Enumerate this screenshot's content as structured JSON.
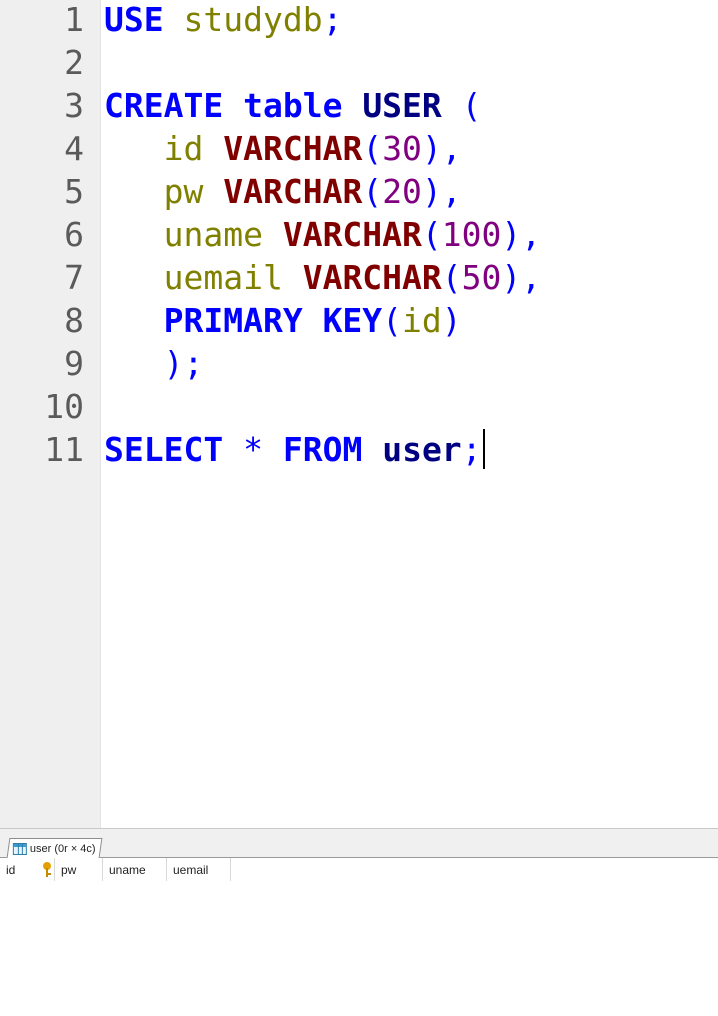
{
  "editor": {
    "line_numbers": [
      "1",
      "2",
      "3",
      "4",
      "5",
      "6",
      "7",
      "8",
      "9",
      "10",
      "11"
    ],
    "lines": [
      {
        "tokens": [
          {
            "t": "USE",
            "c": "kw"
          },
          {
            "t": " ",
            "c": ""
          },
          {
            "t": "studydb",
            "c": "id"
          },
          {
            "t": ";",
            "c": "punct"
          }
        ]
      },
      {
        "tokens": []
      },
      {
        "tokens": [
          {
            "t": "CREATE",
            "c": "kw"
          },
          {
            "t": " ",
            "c": ""
          },
          {
            "t": "table",
            "c": "kw"
          },
          {
            "t": " ",
            "c": ""
          },
          {
            "t": "USER",
            "c": "tbl"
          },
          {
            "t": " (",
            "c": "punct"
          }
        ]
      },
      {
        "tokens": [
          {
            "t": "   ",
            "c": ""
          },
          {
            "t": "id",
            "c": "id"
          },
          {
            "t": " ",
            "c": ""
          },
          {
            "t": "VARCHAR",
            "c": "type"
          },
          {
            "t": "(",
            "c": "punct"
          },
          {
            "t": "30",
            "c": "num"
          },
          {
            "t": "),",
            "c": "punct"
          }
        ]
      },
      {
        "tokens": [
          {
            "t": "   ",
            "c": ""
          },
          {
            "t": "pw",
            "c": "id"
          },
          {
            "t": " ",
            "c": ""
          },
          {
            "t": "VARCHAR",
            "c": "type"
          },
          {
            "t": "(",
            "c": "punct"
          },
          {
            "t": "20",
            "c": "num"
          },
          {
            "t": "),",
            "c": "punct"
          }
        ]
      },
      {
        "tokens": [
          {
            "t": "   ",
            "c": ""
          },
          {
            "t": "uname",
            "c": "id"
          },
          {
            "t": " ",
            "c": ""
          },
          {
            "t": "VARCHAR",
            "c": "type"
          },
          {
            "t": "(",
            "c": "punct"
          },
          {
            "t": "100",
            "c": "num"
          },
          {
            "t": "),",
            "c": "punct"
          }
        ]
      },
      {
        "tokens": [
          {
            "t": "   ",
            "c": ""
          },
          {
            "t": "uemail",
            "c": "id"
          },
          {
            "t": " ",
            "c": ""
          },
          {
            "t": "VARCHAR",
            "c": "type"
          },
          {
            "t": "(",
            "c": "punct"
          },
          {
            "t": "50",
            "c": "num"
          },
          {
            "t": "),",
            "c": "punct"
          }
        ]
      },
      {
        "tokens": [
          {
            "t": "   ",
            "c": ""
          },
          {
            "t": "PRIMARY",
            "c": "kw"
          },
          {
            "t": " ",
            "c": ""
          },
          {
            "t": "KEY",
            "c": "kw"
          },
          {
            "t": "(",
            "c": "punct"
          },
          {
            "t": "id",
            "c": "id"
          },
          {
            "t": ")",
            "c": "punct"
          }
        ]
      },
      {
        "tokens": [
          {
            "t": "   ",
            "c": ""
          },
          {
            "t": ");",
            "c": "punct"
          }
        ]
      },
      {
        "tokens": []
      },
      {
        "tokens": [
          {
            "t": "SELECT",
            "c": "kw"
          },
          {
            "t": " ",
            "c": ""
          },
          {
            "t": "*",
            "c": "punct"
          },
          {
            "t": " ",
            "c": ""
          },
          {
            "t": "FROM",
            "c": "kw"
          },
          {
            "t": " ",
            "c": ""
          },
          {
            "t": "user",
            "c": "tbl"
          },
          {
            "t": ";",
            "c": "punct"
          }
        ]
      }
    ],
    "cursor_line": 11
  },
  "result_tab": {
    "label": "user (0r × 4c)",
    "icon": "table-icon"
  },
  "result_grid": {
    "columns": [
      {
        "label": "id",
        "width": 55,
        "key": true
      },
      {
        "label": "pw",
        "width": 48,
        "key": false
      },
      {
        "label": "uname",
        "width": 64,
        "key": false
      },
      {
        "label": "uemail",
        "width": 64,
        "key": false
      }
    ]
  },
  "colors": {
    "keyword": "#0000ff",
    "identifier": "#808000",
    "type": "#800000",
    "number": "#800080",
    "table_name": "#000080"
  }
}
